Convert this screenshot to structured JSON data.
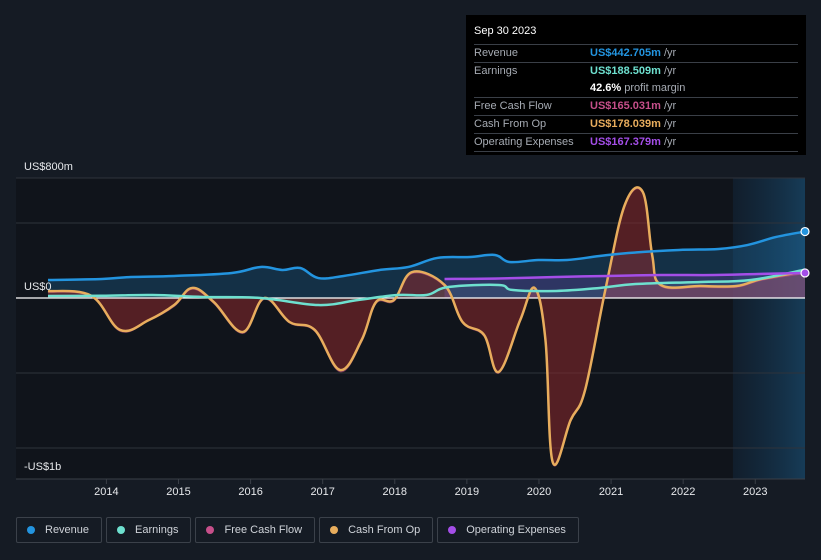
{
  "tooltip": {
    "date": "Sep 30 2023",
    "rows": [
      {
        "label": "Revenue",
        "value": "US$442.705m",
        "unit": "/yr",
        "color": "#2394df"
      },
      {
        "label": "Earnings",
        "value": "US$188.509m",
        "unit": "/yr",
        "color": "#6ee0cf"
      },
      {
        "label": "",
        "value": "42.6%",
        "unit": "profit margin",
        "color": "#ffffff"
      },
      {
        "label": "Free Cash Flow",
        "value": "US$165.031m",
        "unit": "/yr",
        "color": "#c64f8a"
      },
      {
        "label": "Cash From Op",
        "value": "US$178.039m",
        "unit": "/yr",
        "color": "#e8ad5d"
      },
      {
        "label": "Operating Expenses",
        "value": "US$167.379m",
        "unit": "/yr",
        "color": "#a44ee8"
      }
    ]
  },
  "legend": [
    {
      "label": "Revenue",
      "color": "#2394df"
    },
    {
      "label": "Earnings",
      "color": "#6ee0cf"
    },
    {
      "label": "Free Cash Flow",
      "color": "#c64f8a"
    },
    {
      "label": "Cash From Op",
      "color": "#e8ad5d"
    },
    {
      "label": "Operating Expenses",
      "color": "#a44ee8"
    }
  ],
  "chart_data": {
    "type": "line",
    "title": "",
    "xlabel": "",
    "ylabel": "",
    "y_unit": "US$ millions",
    "ylim": [
      -1200,
      800
    ],
    "xlim": [
      2013.25,
      2023.75
    ],
    "y_tick_labels": [
      {
        "value": 800,
        "label": "US$800m"
      },
      {
        "value": 0,
        "label": "US$0"
      },
      {
        "value": -1200,
        "label": "-US$1b"
      }
    ],
    "gridlines": [
      800,
      500,
      0,
      -500,
      -1000
    ],
    "x_ticks": [
      2014,
      2015,
      2016,
      2017,
      2018,
      2019,
      2020,
      2021,
      2022,
      2023
    ],
    "forecast_shade_start": 2022.75,
    "grid": true,
    "legend_position": "bottom",
    "series": [
      {
        "name": "Revenue",
        "color": "#2394df",
        "fill": true,
        "points": [
          [
            2013.25,
            120
          ],
          [
            2014.0,
            127
          ],
          [
            2014.4,
            140
          ],
          [
            2015.0,
            147
          ],
          [
            2015.8,
            167
          ],
          [
            2016.2,
            207
          ],
          [
            2016.5,
            187
          ],
          [
            2016.75,
            200
          ],
          [
            2017.0,
            133
          ],
          [
            2017.35,
            147
          ],
          [
            2017.85,
            187
          ],
          [
            2018.25,
            207
          ],
          [
            2018.65,
            267
          ],
          [
            2019.1,
            273
          ],
          [
            2019.45,
            287
          ],
          [
            2019.65,
            240
          ],
          [
            2020.05,
            253
          ],
          [
            2020.45,
            253
          ],
          [
            2020.9,
            280
          ],
          [
            2021.3,
            300
          ],
          [
            2022.0,
            320
          ],
          [
            2022.55,
            327
          ],
          [
            2022.95,
            353
          ],
          [
            2023.35,
            407
          ],
          [
            2023.75,
            443
          ]
        ]
      },
      {
        "name": "Earnings",
        "color": "#6ee0cf",
        "fill": true,
        "points": [
          [
            2013.25,
            13
          ],
          [
            2014.0,
            15
          ],
          [
            2014.7,
            20
          ],
          [
            2015.4,
            7
          ],
          [
            2016.2,
            0
          ],
          [
            2017.0,
            -47
          ],
          [
            2017.55,
            -13
          ],
          [
            2018.1,
            20
          ],
          [
            2018.5,
            20
          ],
          [
            2018.8,
            73
          ],
          [
            2019.5,
            87
          ],
          [
            2019.7,
            53
          ],
          [
            2020.3,
            47
          ],
          [
            2020.9,
            67
          ],
          [
            2021.4,
            93
          ],
          [
            2022.3,
            107
          ],
          [
            2023.0,
            120
          ],
          [
            2023.75,
            189
          ]
        ]
      },
      {
        "name": "Free Cash Flow",
        "color": "#c64f8a",
        "fill": true,
        "points": [
          [
            2013.25,
            40
          ],
          [
            2013.85,
            10
          ],
          [
            2014.25,
            -220
          ],
          [
            2014.65,
            -150
          ],
          [
            2015.0,
            -55
          ],
          [
            2015.25,
            60
          ],
          [
            2015.55,
            -35
          ],
          [
            2015.95,
            -235
          ],
          [
            2016.25,
            -8
          ],
          [
            2016.6,
            -165
          ],
          [
            2016.95,
            -220
          ],
          [
            2017.3,
            -490
          ],
          [
            2017.6,
            -290
          ],
          [
            2017.8,
            -35
          ],
          [
            2018.05,
            -20
          ],
          [
            2018.3,
            165
          ],
          [
            2018.75,
            80
          ],
          [
            2019.0,
            -165
          ],
          [
            2019.3,
            -255
          ],
          [
            2019.5,
            -500
          ],
          [
            2019.8,
            -155
          ],
          [
            2020.0,
            60
          ],
          [
            2020.15,
            -290
          ],
          [
            2020.25,
            -1100
          ],
          [
            2020.5,
            -820
          ],
          [
            2020.7,
            -620
          ],
          [
            2020.98,
            45
          ],
          [
            2021.25,
            612
          ],
          [
            2021.5,
            700
          ],
          [
            2021.63,
            280
          ],
          [
            2021.75,
            80
          ],
          [
            2022.3,
            73
          ],
          [
            2022.8,
            73
          ],
          [
            2023.15,
            120
          ],
          [
            2023.75,
            165
          ]
        ]
      },
      {
        "name": "Cash From Op",
        "color": "#e8ad5d",
        "fill": true,
        "points": [
          [
            2013.25,
            47
          ],
          [
            2013.85,
            15
          ],
          [
            2014.25,
            -213
          ],
          [
            2014.65,
            -147
          ],
          [
            2015.0,
            -47
          ],
          [
            2015.25,
            67
          ],
          [
            2015.55,
            -27
          ],
          [
            2015.95,
            -227
          ],
          [
            2016.25,
            0
          ],
          [
            2016.6,
            -160
          ],
          [
            2016.95,
            -213
          ],
          [
            2017.3,
            -480
          ],
          [
            2017.6,
            -280
          ],
          [
            2017.8,
            -27
          ],
          [
            2018.05,
            -13
          ],
          [
            2018.3,
            173
          ],
          [
            2018.75,
            87
          ],
          [
            2019.0,
            -160
          ],
          [
            2019.3,
            -247
          ],
          [
            2019.5,
            -493
          ],
          [
            2019.8,
            -147
          ],
          [
            2020.0,
            67
          ],
          [
            2020.15,
            -280
          ],
          [
            2020.25,
            -1093
          ],
          [
            2020.5,
            -813
          ],
          [
            2020.7,
            -613
          ],
          [
            2020.98,
            53
          ],
          [
            2021.25,
            620
          ],
          [
            2021.5,
            707
          ],
          [
            2021.63,
            287
          ],
          [
            2021.75,
            87
          ],
          [
            2022.3,
            80
          ],
          [
            2022.8,
            80
          ],
          [
            2023.15,
            127
          ],
          [
            2023.75,
            178
          ]
        ]
      },
      {
        "name": "Operating Expenses",
        "color": "#a44ee8",
        "fill": true,
        "points": [
          [
            2018.75,
            127
          ],
          [
            2019.5,
            130
          ],
          [
            2020.3,
            140
          ],
          [
            2021.0,
            147
          ],
          [
            2021.75,
            153
          ],
          [
            2022.5,
            153
          ],
          [
            2023.1,
            160
          ],
          [
            2023.75,
            167
          ]
        ]
      }
    ]
  }
}
